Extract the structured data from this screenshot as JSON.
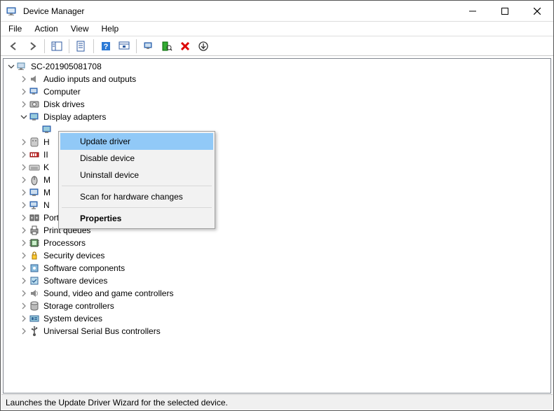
{
  "window": {
    "title": "Device Manager"
  },
  "menubar": {
    "items": [
      "File",
      "Action",
      "View",
      "Help"
    ]
  },
  "toolbar": {
    "back": "back-icon",
    "forward": "forward-icon",
    "showhide": "showhide-icon",
    "props": "properties-icon",
    "help": "help-icon",
    "action": "action-icon",
    "monitor": "monitor-icon",
    "scan": "scan-icon",
    "remove": "remove-icon",
    "refresh": "refresh-icon"
  },
  "tree": {
    "root": "SC-201905081708",
    "categories": [
      {
        "label": "Audio inputs and outputs",
        "icon": "audio"
      },
      {
        "label": "Computer",
        "icon": "computer"
      },
      {
        "label": "Disk drives",
        "icon": "disk"
      },
      {
        "label": "Display adapters",
        "icon": "display",
        "expanded": true
      },
      {
        "label": "H",
        "icon": "hid",
        "truncated": true
      },
      {
        "label": "II",
        "icon": "ide",
        "truncated": true
      },
      {
        "label": "K",
        "icon": "keyboard",
        "truncated": true
      },
      {
        "label": "M",
        "icon": "mouse",
        "truncated": true
      },
      {
        "label": "M",
        "icon": "monitor",
        "truncated": true
      },
      {
        "label": "N",
        "icon": "network",
        "truncated": true
      },
      {
        "label": "Ports (COM & LPT)",
        "icon": "ports"
      },
      {
        "label": "Print queues",
        "icon": "print"
      },
      {
        "label": "Processors",
        "icon": "processor"
      },
      {
        "label": "Security devices",
        "icon": "security"
      },
      {
        "label": "Software components",
        "icon": "softcomp"
      },
      {
        "label": "Software devices",
        "icon": "softdev"
      },
      {
        "label": "Sound, video and game controllers",
        "icon": "sound"
      },
      {
        "label": "Storage controllers",
        "icon": "storage"
      },
      {
        "label": "System devices",
        "icon": "system"
      },
      {
        "label": "Universal Serial Bus controllers",
        "icon": "usb"
      }
    ]
  },
  "context_menu": {
    "items": [
      {
        "label": "Update driver",
        "highlight": true
      },
      {
        "label": "Disable device"
      },
      {
        "label": "Uninstall device"
      },
      {
        "sep": true
      },
      {
        "label": "Scan for hardware changes"
      },
      {
        "sep": true
      },
      {
        "label": "Properties",
        "bold": true
      }
    ]
  },
  "statusbar": {
    "text": "Launches the Update Driver Wizard for the selected device."
  }
}
